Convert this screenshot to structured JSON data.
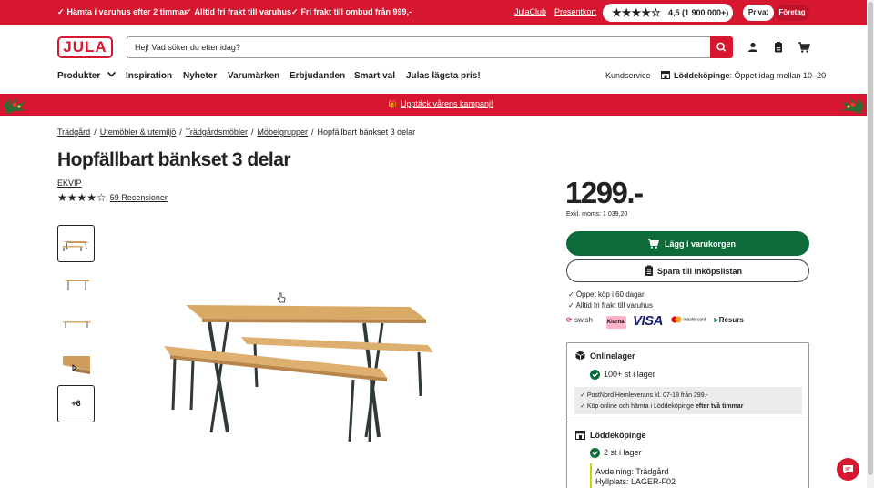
{
  "topbar": {
    "usps": [
      "Hämta i varuhus efter 2 timmar",
      "Alltid fri frakt till varuhus",
      "Fri frakt till ombud från 999,-"
    ],
    "links": [
      "JulaClub",
      "Presentkort"
    ],
    "rating_score": "4,5 (1 900 000+)",
    "rating_stars": "★★★★☆",
    "segment_privat": "Privat",
    "segment_foretag": "Företag"
  },
  "header": {
    "logo": "JULA",
    "search_placeholder": "Hej! Vad söker du efter idag?"
  },
  "nav": {
    "items": [
      "Produkter",
      "Inspiration",
      "Nyheter",
      "Varumärken",
      "Erbjudanden",
      "Smart val",
      "Julas lägsta pris!"
    ],
    "customer_service": "Kundservice",
    "store_name": "Löddeköpinge",
    "store_hours": ": Öppet idag mellan 10–20"
  },
  "banner": {
    "icon": "🎁",
    "text": "Upptäck vårens kampanj!"
  },
  "breadcrumb": [
    "Trädgård",
    "Utemöbler & utemiljö",
    "Trädgårdsmöbler",
    "Möbelgrupper",
    "Hopfällbart bänkset 3 delar"
  ],
  "product": {
    "title": "Hopfällbart bänkset 3 delar",
    "brand": "EKVIP",
    "stars": "★★★★☆",
    "reviews": "59 Recensioner",
    "more_images": "+6",
    "price": "1299.-",
    "ex_vat": "Exkl. moms: 1 039,20"
  },
  "buybox": {
    "add_to_cart": "Lägg i varukorgen",
    "save_list": "Spara till inköpslistan",
    "perks": [
      "Öppet köp i 60 dagar",
      "Alltid fri frakt till varuhus"
    ],
    "payments": {
      "swish": "swish",
      "klarna": "Klarna.",
      "visa": "VISA",
      "mastercard": "mastercard",
      "resurs": "Resurs"
    }
  },
  "stock": {
    "online_title": "Onlinelager",
    "online_qty": "100+ st i lager",
    "delivery_1": "PostNord Hemleverans kl. 07-18 från 299.-",
    "delivery_2_prefix": "Köp online och hämta i Löddeköpinge ",
    "delivery_2_bold": "efter två timmar",
    "store_title": "Löddeköpinge",
    "store_qty": "2 st i lager",
    "department": "Avdelning: Trädgård",
    "shelf": "Hyllplats: LAGER-F02"
  },
  "colors": {
    "brand_red": "#d7172f",
    "cta_green": "#0d6b3a"
  }
}
